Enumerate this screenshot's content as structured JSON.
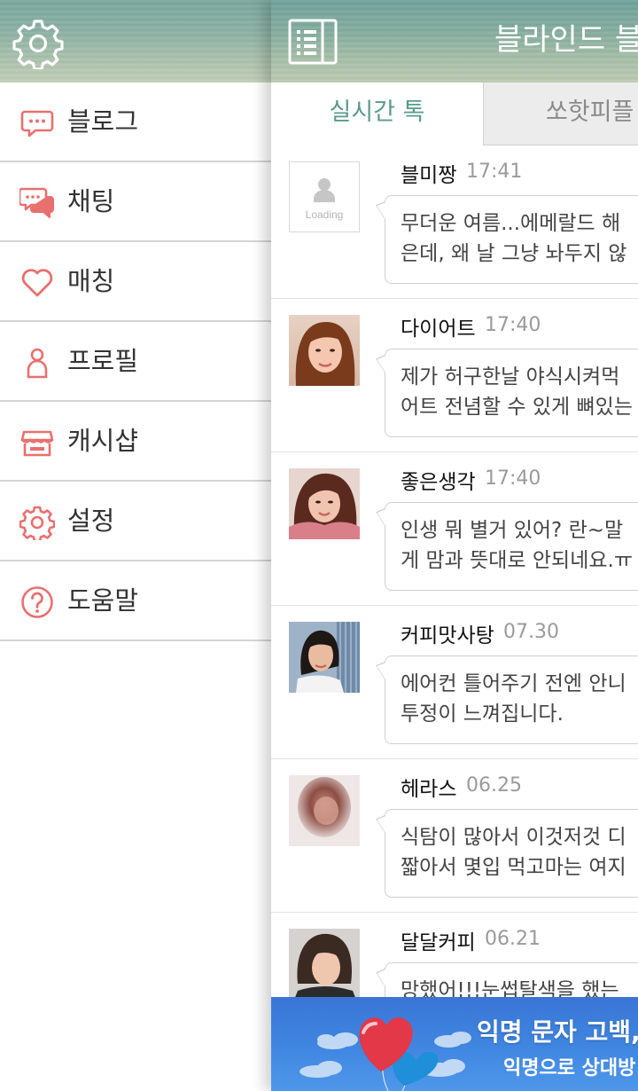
{
  "drawer": {
    "header": {
      "settings_icon": "gear-icon"
    },
    "items": [
      {
        "label": "블로그",
        "icon": "speech-bubble-icon"
      },
      {
        "label": "채팅",
        "icon": "chat-bubbles-icon"
      },
      {
        "label": "매칭",
        "icon": "heart-icon"
      },
      {
        "label": "프로필",
        "icon": "person-icon"
      },
      {
        "label": "캐시샵",
        "icon": "shop-icon"
      },
      {
        "label": "설정",
        "icon": "gear-icon"
      },
      {
        "label": "도움말",
        "icon": "question-icon"
      }
    ],
    "icon_color": "#e8706f"
  },
  "main": {
    "title": "블라인드 블로그",
    "menu_icon": "list-menu-icon",
    "tabs": [
      {
        "label": "실시간 톡",
        "active": true
      },
      {
        "label": "쏘핫피플",
        "active": false
      }
    ],
    "accent_color": "#5a9a8e",
    "posts": [
      {
        "author": "블미짱",
        "time": "17:41",
        "avatar": "placeholder",
        "avatar_text": "Loading",
        "lines": [
          "무더운 여름...에메랄드 해",
          "은데, 왜 날 그냥 놔두지 않"
        ]
      },
      {
        "author": "다이어트",
        "time": "17:40",
        "avatar": "photo",
        "lines": [
          "제가 허구한날 야식시켜먹",
          "어트 전념할 수 있게 뼈있는"
        ]
      },
      {
        "author": "좋은생각",
        "time": "17:40",
        "avatar": "photo",
        "lines": [
          "인생 뭐 별거 있어? 란~말",
          "게 맘과 뜻대로 안되네요.ㅠ"
        ]
      },
      {
        "author": "커피맛사탕",
        "time": "07.30",
        "avatar": "photo",
        "lines": [
          "에어컨 틀어주기 전엔 안니",
          "투정이 느껴집니다."
        ]
      },
      {
        "author": "헤라스",
        "time": "06.25",
        "avatar": "blurred",
        "lines": [
          "식탐이 많아서 이것저것 디",
          "짧아서 몇입 먹고마는 여지"
        ]
      },
      {
        "author": "달달커피",
        "time": "06.21",
        "avatar": "photo",
        "lines": [
          "망했어!!!눈썹탈색을 했는"
        ]
      }
    ]
  },
  "banner": {
    "headline": "익명 문자 고백,",
    "subline": "익명으로 상대방",
    "bg_color": "#3f85e0"
  }
}
